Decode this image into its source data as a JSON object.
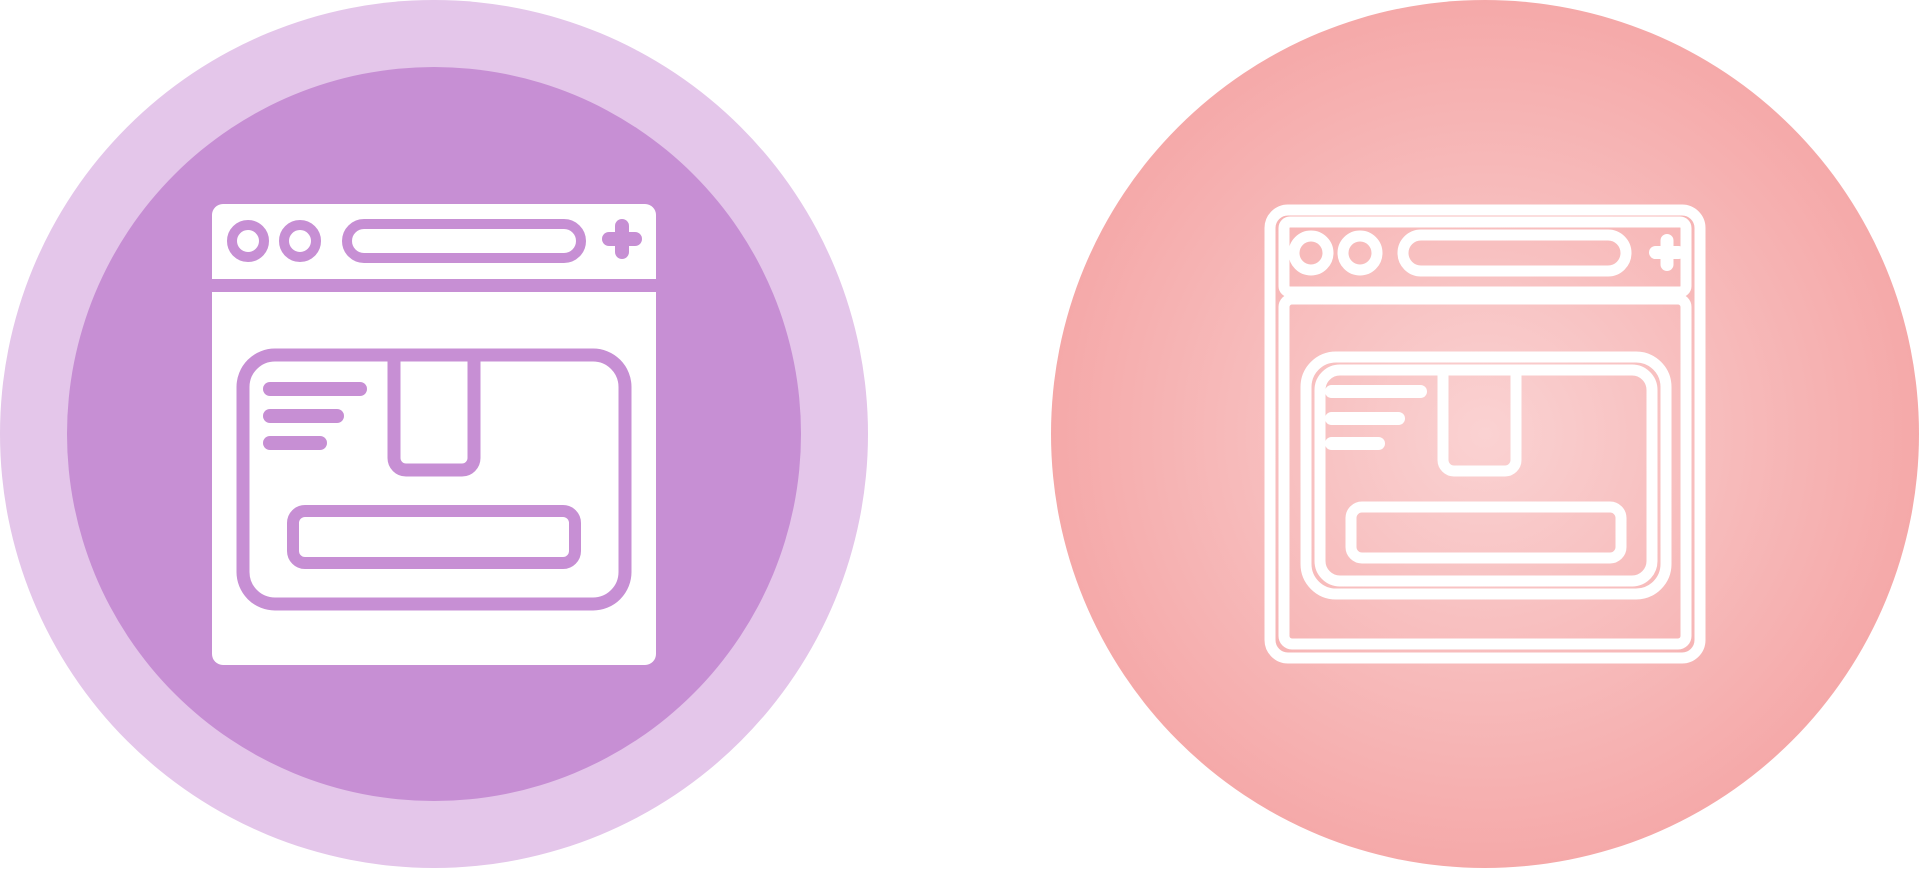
{
  "icons": [
    {
      "name": "web-browser-glyph-icon",
      "style": "glyph",
      "colors": {
        "outer_ring": "#e4c6ea",
        "inner_disc": "#c78fd4",
        "glyph": "#ffffff",
        "cutout": "#c78fd4"
      }
    },
    {
      "name": "web-browser-outline-icon",
      "style": "outline",
      "colors": {
        "disc_center": "#fad2d2",
        "disc_edge": "#f5a9a9",
        "stroke": "#ffffff"
      }
    }
  ]
}
